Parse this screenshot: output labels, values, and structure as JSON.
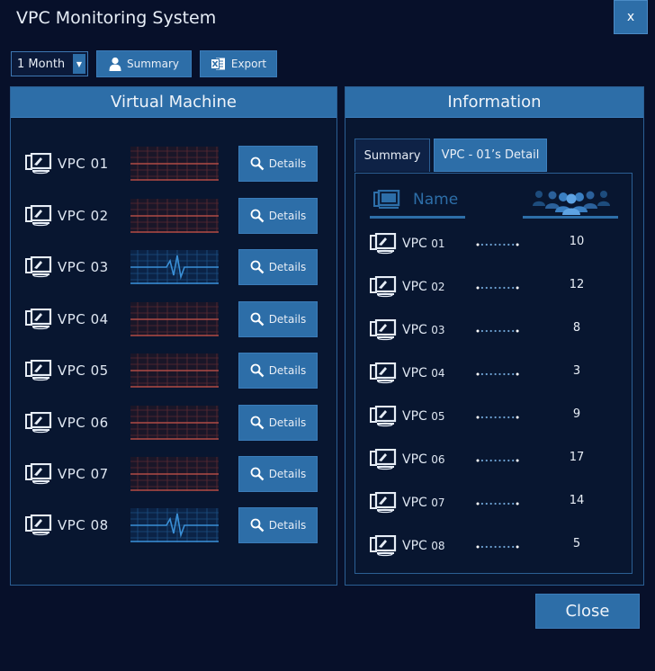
{
  "window": {
    "title": "VPC Monitoring System",
    "close_x": "x"
  },
  "toolbar": {
    "period_value": "1 Month",
    "summary_label": "Summary",
    "export_label": "Export"
  },
  "vm_panel": {
    "title": "Virtual Machine",
    "details_label": "Details",
    "rows": [
      {
        "prefix": "VPC",
        "num": "01",
        "wave": "red"
      },
      {
        "prefix": "VPC",
        "num": "02",
        "wave": "red"
      },
      {
        "prefix": "VPC",
        "num": "03",
        "wave": "blue"
      },
      {
        "prefix": "VPC",
        "num": "04",
        "wave": "red"
      },
      {
        "prefix": "VPC",
        "num": "05",
        "wave": "red"
      },
      {
        "prefix": "VPC",
        "num": "06",
        "wave": "red"
      },
      {
        "prefix": "VPC",
        "num": "07",
        "wave": "red"
      },
      {
        "prefix": "VPC",
        "num": "08",
        "wave": "blue"
      }
    ]
  },
  "info_panel": {
    "title": "Information",
    "tabs": {
      "summary": "Summary",
      "detail": "VPC - 01’s Detail"
    },
    "col_name": "Name",
    "rows": [
      {
        "prefix": "VPC",
        "num": "01",
        "count": "10"
      },
      {
        "prefix": "VPC",
        "num": "02",
        "count": "12"
      },
      {
        "prefix": "VPC",
        "num": "03",
        "count": "8"
      },
      {
        "prefix": "VPC",
        "num": "04",
        "count": "3"
      },
      {
        "prefix": "VPC",
        "num": "05",
        "count": "9"
      },
      {
        "prefix": "VPC",
        "num": "06",
        "count": "17"
      },
      {
        "prefix": "VPC",
        "num": "07",
        "count": "14"
      },
      {
        "prefix": "VPC",
        "num": "08",
        "count": "5"
      }
    ]
  },
  "footer": {
    "close_label": "Close"
  },
  "colors": {
    "accent": "#2d6ea8",
    "background": "#07102a",
    "wave_red": "#c0504d",
    "wave_blue": "#3a8fd6"
  },
  "icons": [
    "user-icon",
    "excel-icon",
    "computer-icon",
    "search-icon",
    "users-group-icon"
  ]
}
